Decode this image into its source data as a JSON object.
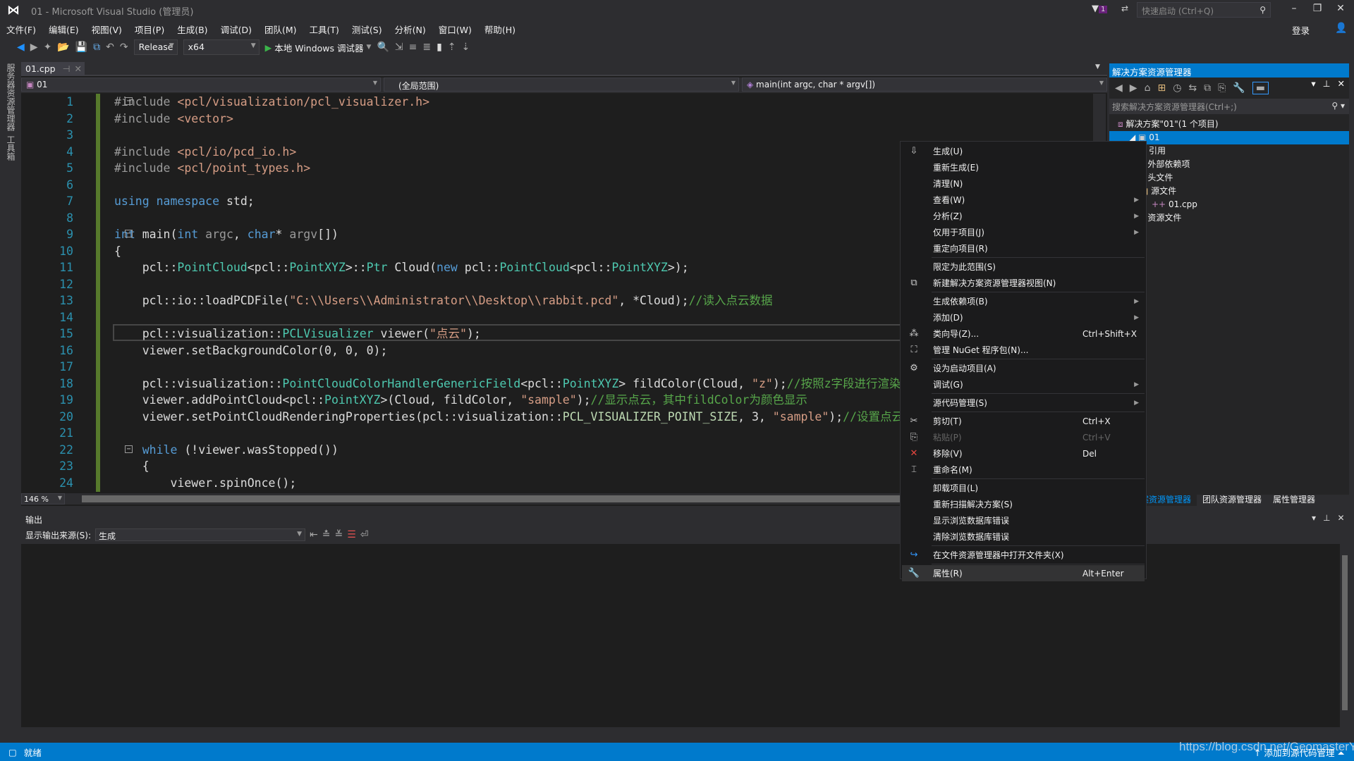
{
  "window": {
    "title": "01 - Microsoft Visual Studio (管理员)",
    "quick_launch_placeholder": "快速启动 (Ctrl+Q)",
    "notification_count": "1",
    "login": "登录"
  },
  "menu": [
    "文件(F)",
    "编辑(E)",
    "视图(V)",
    "项目(P)",
    "生成(B)",
    "调试(D)",
    "团队(M)",
    "工具(T)",
    "测试(S)",
    "分析(N)",
    "窗口(W)",
    "帮助(H)"
  ],
  "toolbar": {
    "configuration": "Release",
    "platform": "x64",
    "debugger": "本地 Windows 调试器"
  },
  "left_strip": [
    "服务器资源管理器",
    "工具箱"
  ],
  "editor": {
    "tab": "01.cpp",
    "nav_project": "01",
    "nav_scope": "(全局范围)",
    "nav_function": "main(int argc, char * argv[])",
    "zoom": "146 %",
    "lines": [
      [
        [
          "pp",
          "#include "
        ],
        [
          "str",
          "<pcl/visualization/pcl_visualizer.h>"
        ]
      ],
      [
        [
          "pp",
          "#include "
        ],
        [
          "str",
          "<vector>"
        ]
      ],
      [],
      [
        [
          "pp",
          "#include "
        ],
        [
          "str",
          "<pcl/io/pcd_io.h>"
        ]
      ],
      [
        [
          "pp",
          "#include "
        ],
        [
          "str",
          "<pcl/point_types.h>"
        ]
      ],
      [],
      [
        [
          "kw",
          "using namespace "
        ],
        [
          "pl",
          "std;"
        ]
      ],
      [],
      [
        [
          "kw",
          "int "
        ],
        [
          "pl",
          "main("
        ],
        [
          "kw",
          "int "
        ],
        [
          "par",
          "argc"
        ],
        [
          "pl",
          ", "
        ],
        [
          "kw",
          "char"
        ],
        [
          "pl",
          "* "
        ],
        [
          "par",
          "argv"
        ],
        [
          "pl",
          "[])"
        ]
      ],
      [
        [
          "pl",
          "{"
        ]
      ],
      [
        [
          "pl",
          "    pcl::"
        ],
        [
          "ty",
          "PointCloud"
        ],
        [
          "pl",
          "<pcl::"
        ],
        [
          "ty",
          "PointXYZ"
        ],
        [
          "pl",
          ">::"
        ],
        [
          "ty",
          "Ptr"
        ],
        [
          "pl",
          " Cloud("
        ],
        [
          "kw",
          "new "
        ],
        [
          "pl",
          "pcl::"
        ],
        [
          "ty",
          "PointCloud"
        ],
        [
          "pl",
          "<pcl::"
        ],
        [
          "ty",
          "PointXYZ"
        ],
        [
          "pl",
          ">);"
        ]
      ],
      [],
      [
        [
          "pl",
          "    pcl::io::loadPCDFile("
        ],
        [
          "str",
          "\"C:\\\\Users\\\\Administrator\\\\Desktop\\\\rabbit.pcd\""
        ],
        [
          "pl",
          ", *Cloud);"
        ],
        [
          "cm",
          "//读入点云数据"
        ]
      ],
      [],
      [
        [
          "pl",
          "    pcl::visualization::"
        ],
        [
          "ty",
          "PCLVisualizer"
        ],
        [
          "pl",
          " viewer("
        ],
        [
          "str",
          "\"点云\""
        ],
        [
          "pl",
          ");"
        ]
      ],
      [
        [
          "pl",
          "    viewer.setBackgroundColor(0, 0, 0);"
        ]
      ],
      [],
      [
        [
          "pl",
          "    pcl::visualization::"
        ],
        [
          "ty",
          "PointCloudColorHandlerGenericField"
        ],
        [
          "pl",
          "<pcl::"
        ],
        [
          "ty",
          "PointXYZ"
        ],
        [
          "pl",
          "> fildColor(Cloud, "
        ],
        [
          "str",
          "\"z\""
        ],
        [
          "pl",
          ");"
        ],
        [
          "cm",
          "//按照z字段进行渲染"
        ]
      ],
      [
        [
          "pl",
          "    viewer.addPointCloud<pcl::"
        ],
        [
          "ty",
          "PointXYZ"
        ],
        [
          "pl",
          ">(Cloud, fildColor, "
        ],
        [
          "str",
          "\"sample\""
        ],
        [
          "pl",
          ");"
        ],
        [
          "cm",
          "//显示点云，其中fildColor为颜色显示"
        ]
      ],
      [
        [
          "pl",
          "    viewer.setPointCloudRenderingProperties(pcl::visualization::"
        ],
        [
          "mac",
          "PCL_VISUALIZER_POINT_SIZE"
        ],
        [
          "pl",
          ", 3, "
        ],
        [
          "str",
          "\"sample\""
        ],
        [
          "pl",
          ");"
        ],
        [
          "cm",
          "//设置点云大小"
        ]
      ],
      [],
      [
        [
          "kw",
          "    while "
        ],
        [
          "pl",
          "(!viewer.wasStopped())"
        ]
      ],
      [
        [
          "pl",
          "    {"
        ]
      ],
      [
        [
          "pl",
          "        viewer.spinOnce();"
        ]
      ],
      [
        [
          "pl",
          "    }"
        ]
      ]
    ]
  },
  "output": {
    "title": "输出",
    "source_label": "显示输出来源(S):",
    "source_value": "生成"
  },
  "solution_explorer": {
    "title": "解决方案资源管理器",
    "search_placeholder": "搜索解决方案资源管理器(Ctrl+;)",
    "tree": [
      {
        "label": "解决方案\"01\"(1 个项目)",
        "indent": 0,
        "icon": "solution-icon"
      },
      {
        "label": "01",
        "indent": 1,
        "icon": "project-icon",
        "selected": true
      },
      {
        "label": "引用",
        "indent": 2,
        "icon": "references-icon"
      },
      {
        "label": "外部依赖项",
        "indent": 2,
        "icon": "folder-icon"
      },
      {
        "label": "头文件",
        "indent": 2,
        "icon": "folder-icon"
      },
      {
        "label": "源文件",
        "indent": 2,
        "icon": "folder-open-icon"
      },
      {
        "label": "01.cpp",
        "indent": 3,
        "icon": "cpp-file-icon"
      },
      {
        "label": "资源文件",
        "indent": 2,
        "icon": "folder-icon"
      }
    ],
    "tabs": [
      "解决方案资源管理器",
      "团队资源管理器",
      "属性管理器"
    ]
  },
  "context_menu": [
    {
      "label": "生成(U)",
      "icon": "build-icon"
    },
    {
      "label": "重新生成(E)"
    },
    {
      "label": "清理(N)"
    },
    {
      "label": "查看(W)",
      "submenu": true
    },
    {
      "label": "分析(Z)",
      "submenu": true
    },
    {
      "label": "仅用于项目(J)",
      "submenu": true
    },
    {
      "label": "重定向项目(R)"
    },
    {
      "sep": true
    },
    {
      "label": "限定为此范围(S)"
    },
    {
      "label": "新建解决方案资源管理器视图(N)",
      "icon": "new-view-icon"
    },
    {
      "sep": true
    },
    {
      "label": "生成依赖项(B)",
      "submenu": true
    },
    {
      "label": "添加(D)",
      "submenu": true
    },
    {
      "label": "类向导(Z)...",
      "shortcut": "Ctrl+Shift+X",
      "icon": "class-wizard-icon"
    },
    {
      "label": "管理 NuGet 程序包(N)...",
      "icon": "nuget-icon"
    },
    {
      "sep": true
    },
    {
      "label": "设为启动项目(A)",
      "icon": "gear-icon"
    },
    {
      "label": "调试(G)",
      "submenu": true
    },
    {
      "sep": true
    },
    {
      "label": "源代码管理(S)",
      "submenu": true
    },
    {
      "sep": true
    },
    {
      "label": "剪切(T)",
      "shortcut": "Ctrl+X",
      "icon": "scissors-icon"
    },
    {
      "label": "粘贴(P)",
      "shortcut": "Ctrl+V",
      "icon": "paste-icon",
      "disabled": true
    },
    {
      "label": "移除(V)",
      "shortcut": "Del",
      "icon": "remove-icon"
    },
    {
      "label": "重命名(M)",
      "icon": "rename-icon"
    },
    {
      "sep": true
    },
    {
      "label": "卸载项目(L)"
    },
    {
      "label": "重新扫描解决方案(S)"
    },
    {
      "label": "显示浏览数据库错误"
    },
    {
      "label": "清除浏览数据库错误"
    },
    {
      "sep": true
    },
    {
      "label": "在文件资源管理器中打开文件夹(X)",
      "icon": "open-folder-icon"
    },
    {
      "sep": true
    },
    {
      "label": "属性(R)",
      "shortcut": "Alt+Enter",
      "icon": "wrench-icon",
      "highlighted": true
    }
  ],
  "status": {
    "text": "就绪",
    "source_control": "添加到源代码管理"
  },
  "watermark": "https://blog.csdn.net/GeomasterYi",
  "colors": {
    "accent": "#007acc",
    "editor_bg": "#1e1e1e",
    "chrome_bg": "#2d2d30",
    "keyword": "#569cd6",
    "type": "#4ec9b0",
    "string": "#d69d85",
    "comment": "#57a64a",
    "line_number": "#2b91af"
  }
}
